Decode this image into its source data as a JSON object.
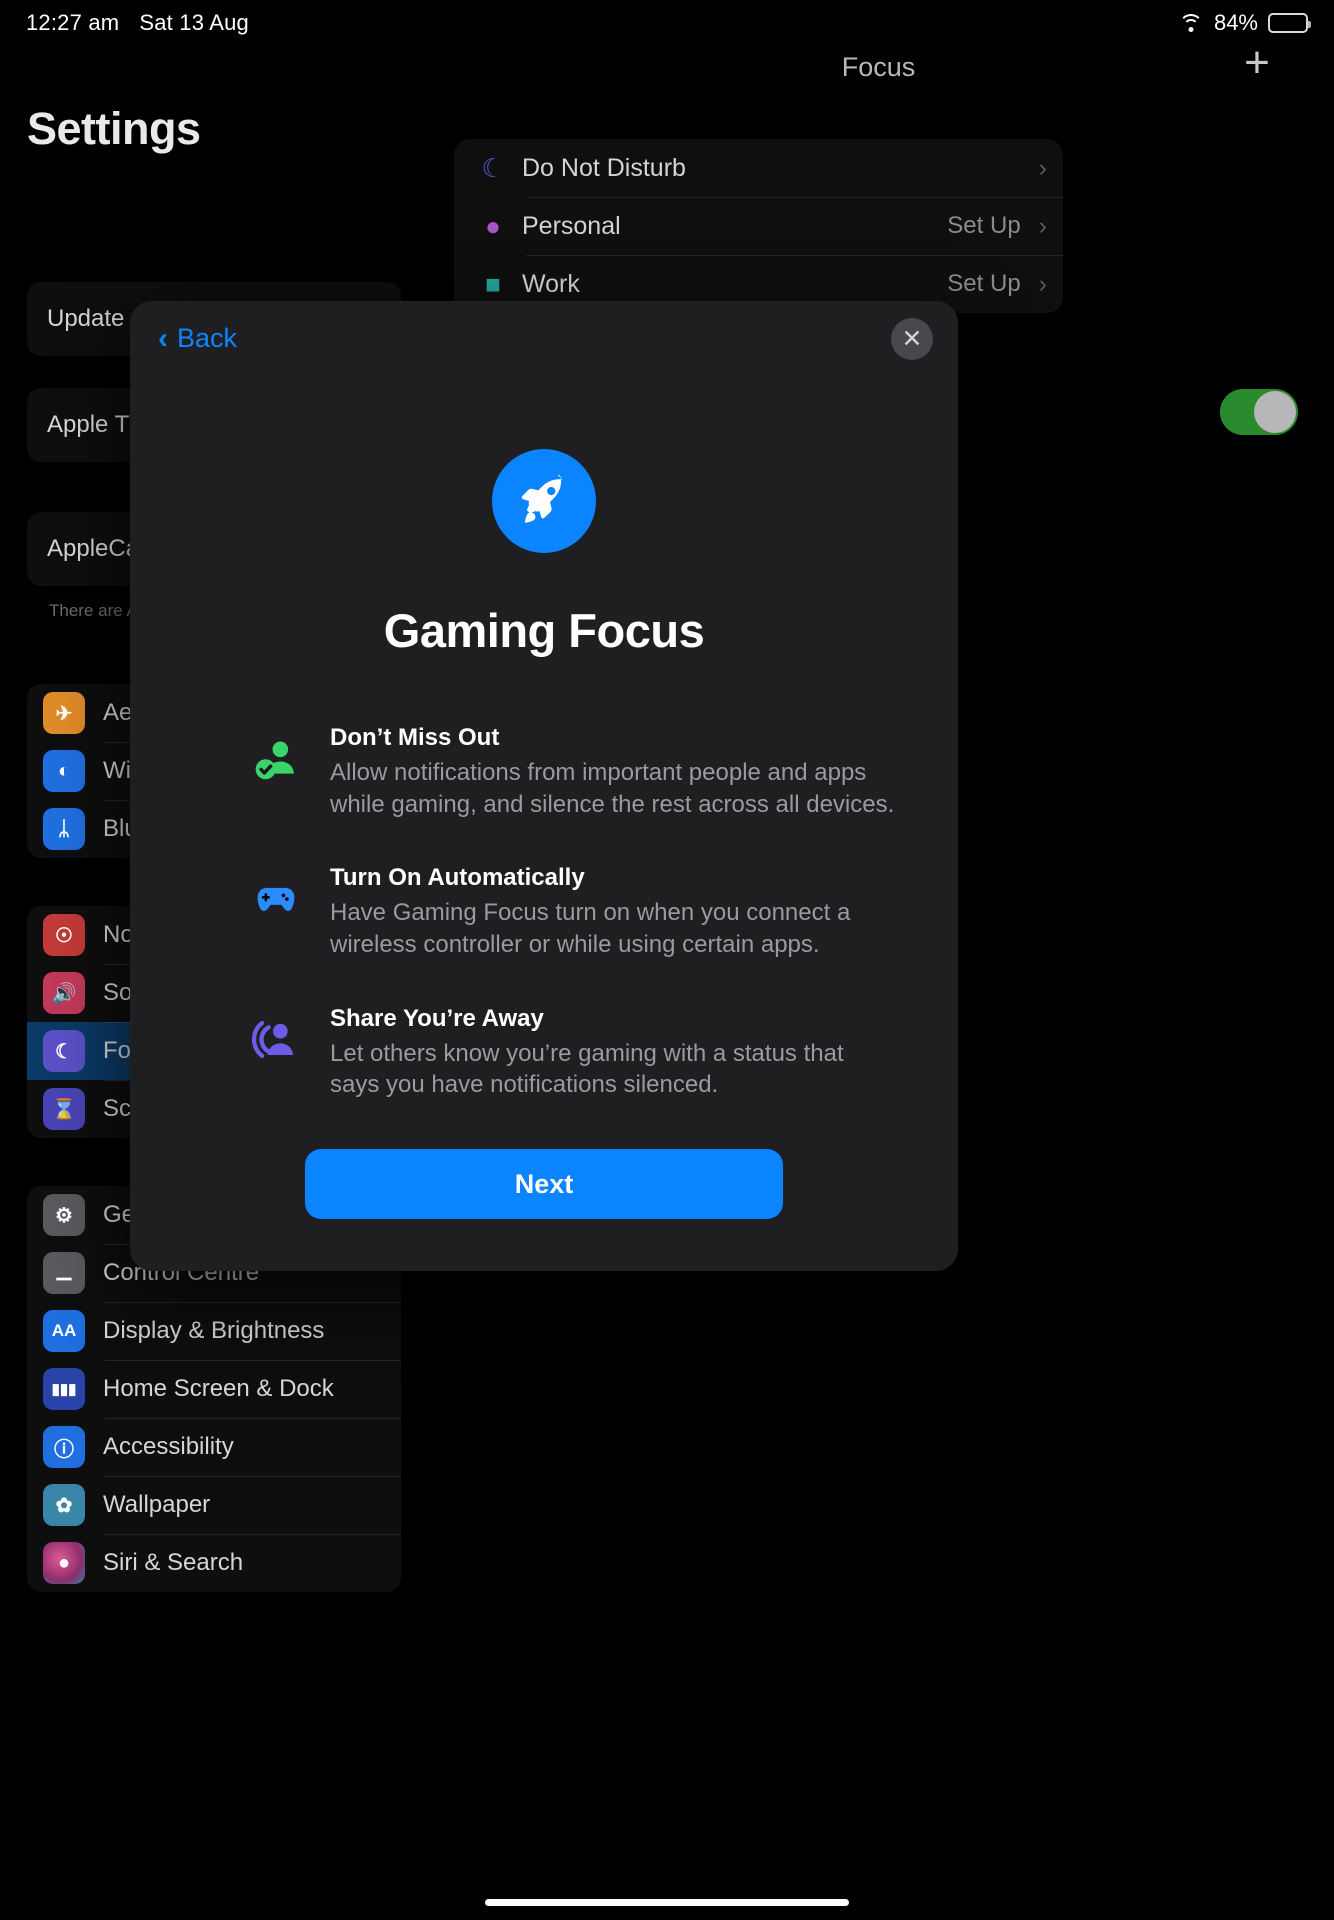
{
  "status_bar": {
    "time": "12:27 am",
    "date": "Sat 13 Aug",
    "battery_percent": "84%",
    "wifi_icon": "wifi-icon",
    "battery_icon": "battery-icon"
  },
  "sidebar": {
    "title": "Settings",
    "update_card": "Update ",
    "appletv_card": "Apple TV",
    "applecare_card": "AppleCare Coverag",
    "applecare_note": "There are  AppleCare",
    "groups": [
      {
        "items": [
          {
            "label": "Ae",
            "icon": "airplane-icon",
            "color": "#e08b29",
            "glyph": "✈"
          },
          {
            "label": "Wi",
            "icon": "wifi-icon",
            "color": "#1f6fe0",
            "glyph": "◔"
          },
          {
            "label": "Blu",
            "icon": "bluetooth-icon",
            "color": "#1f6fe0",
            "glyph": "ᛦ"
          }
        ]
      },
      {
        "items": [
          {
            "label": "No",
            "icon": "notifications-icon",
            "color": "#c23b38",
            "glyph": "🔔"
          },
          {
            "label": "So",
            "icon": "sounds-icon",
            "color": "#c2395a",
            "glyph": "🔊"
          },
          {
            "label": "Fo",
            "icon": "focus-icon",
            "color": "#5b50c6",
            "glyph": "☾",
            "selected": true
          },
          {
            "label": "Sc",
            "icon": "screen-time-icon",
            "color": "#4a43b5",
            "glyph": "⌛"
          }
        ]
      },
      {
        "items": [
          {
            "label": "Ge",
            "icon": "general-gear-icon",
            "color": "#5a5a5e",
            "glyph": "⚙"
          },
          {
            "label": "Control Centre",
            "icon": "control-centre-icon",
            "color": "#5a5a5e",
            "glyph": "⚙"
          },
          {
            "label": "Display & Brightness",
            "icon": "display-brightness-icon",
            "color": "#1f6fe0",
            "glyph": "AA"
          },
          {
            "label": "Home Screen & Dock",
            "icon": "home-screen-dock-icon",
            "color": "#2a43a8",
            "glyph": "∷"
          },
          {
            "label": "Accessibility",
            "icon": "accessibility-icon",
            "color": "#1f6fe0",
            "glyph": "Ⓐ"
          },
          {
            "label": "Wallpaper",
            "icon": "wallpaper-icon",
            "color": "#3a86a8",
            "glyph": "✿"
          },
          {
            "label": "Siri & Search",
            "icon": "siri-search-icon",
            "color": "#8e2e6a",
            "glyph": "●"
          }
        ]
      }
    ]
  },
  "detail": {
    "title": "Focus",
    "add_button": "+",
    "rows": [
      {
        "name": "Do Not Disturb",
        "icon": "moon-icon",
        "glyph": "☾",
        "color": "#5b58c9",
        "status": "",
        "chevron": "›"
      },
      {
        "name": "Personal",
        "icon": "person-icon",
        "glyph": "●",
        "color": "#a855c7",
        "status": "Set Up",
        "chevron": "›"
      },
      {
        "name": "Work",
        "icon": "work-briefcase-icon",
        "glyph": "■",
        "color": "#26a69a",
        "status": "Set Up",
        "chevron": "›"
      }
    ],
    "toggle_state": "on"
  },
  "modal": {
    "back_label": "Back",
    "back_icon": "chevron-left-icon",
    "close_icon": "close-icon",
    "hero_icon": "rocket-icon",
    "hero_icon_color": "#0a84ff",
    "title": "Gaming Focus",
    "features": [
      {
        "icon": "person-check-icon",
        "color": "#3ad46b",
        "heading": "Don’t Miss Out",
        "body": "Allow notifications from important people and apps while gaming, and silence the rest across all devices."
      },
      {
        "icon": "game-controller-icon",
        "color": "#2b8cff",
        "heading": "Turn On Automatically",
        "body": "Have Gaming Focus turn on when you connect a wireless controller or while using certain apps."
      },
      {
        "icon": "share-status-icon",
        "color": "#6c5ce7",
        "heading": "Share You’re Away",
        "body": "Let others know you’re gaming with a status that says you have notifications silenced."
      }
    ],
    "next_label": "Next"
  }
}
